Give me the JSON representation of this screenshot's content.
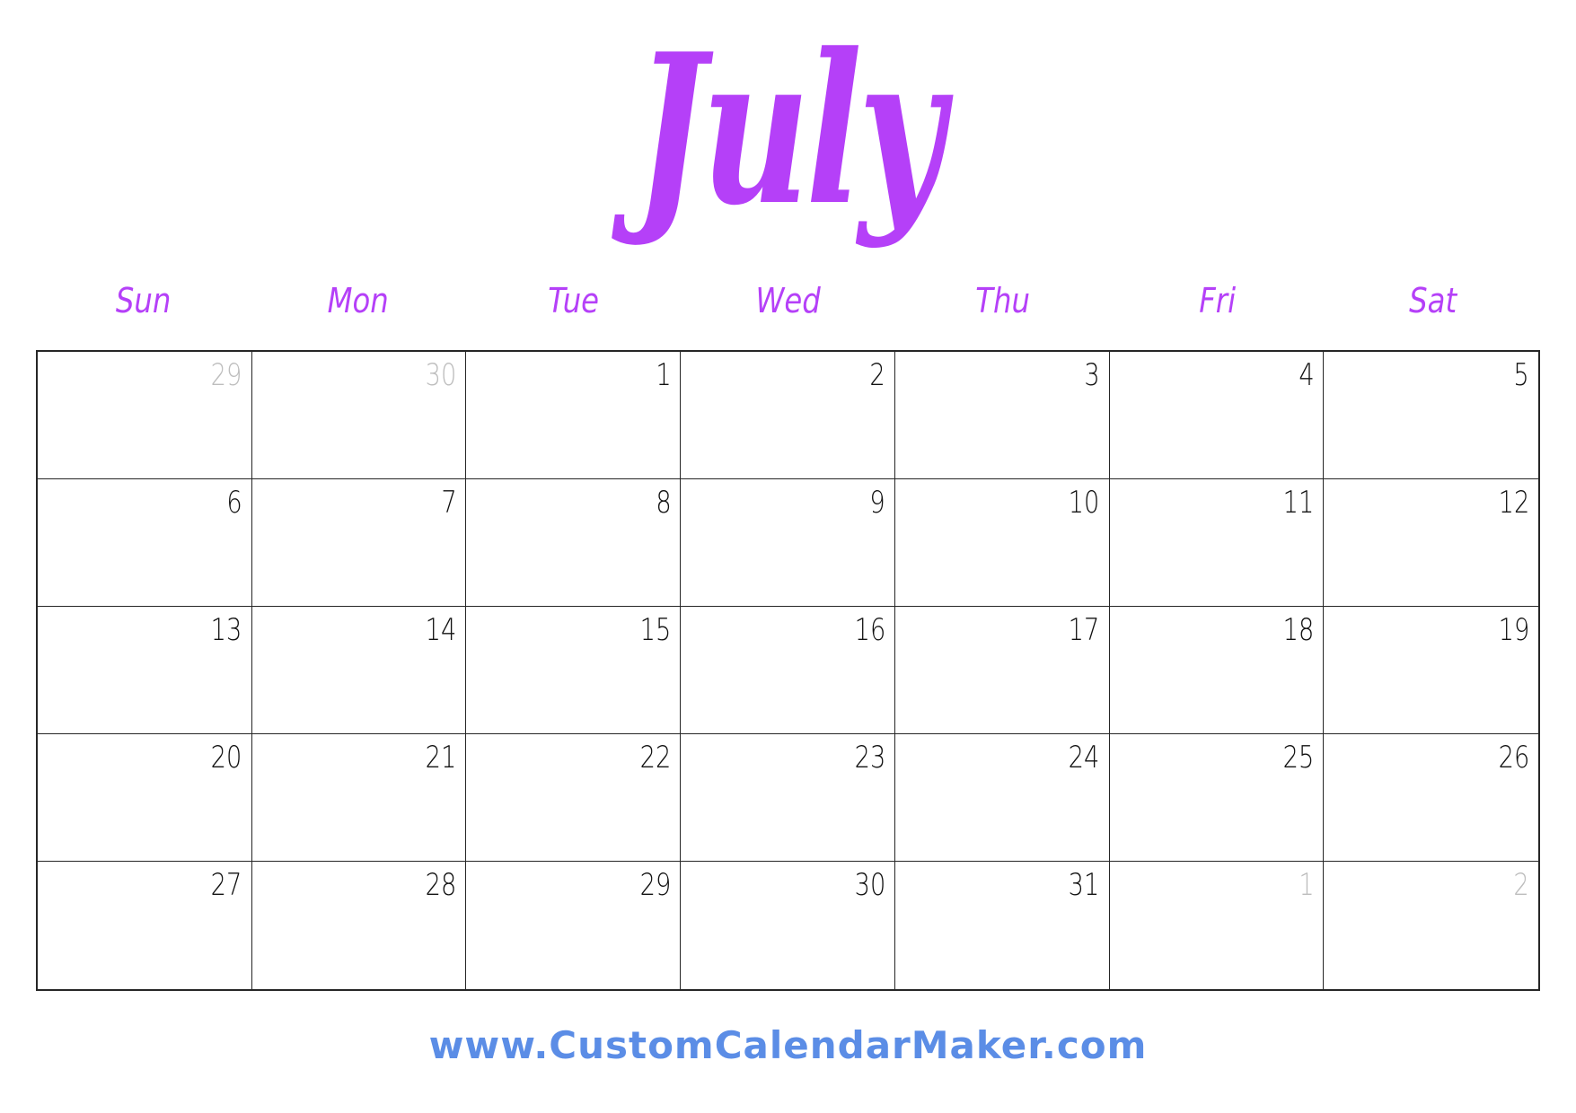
{
  "calendar": {
    "month": "July",
    "colors": {
      "accent": "#b540f8",
      "text": "#111111",
      "muted": "#bdbdbd",
      "footer": "#5b8de6",
      "border": "#262626"
    },
    "weekdays": [
      "Sun",
      "Mon",
      "Tue",
      "Wed",
      "Thu",
      "Fri",
      "Sat"
    ],
    "weeks": [
      [
        {
          "d": "29",
          "other": true
        },
        {
          "d": "30",
          "other": true
        },
        {
          "d": "1"
        },
        {
          "d": "2"
        },
        {
          "d": "3"
        },
        {
          "d": "4"
        },
        {
          "d": "5"
        }
      ],
      [
        {
          "d": "6"
        },
        {
          "d": "7"
        },
        {
          "d": "8"
        },
        {
          "d": "9"
        },
        {
          "d": "10"
        },
        {
          "d": "11"
        },
        {
          "d": "12"
        }
      ],
      [
        {
          "d": "13"
        },
        {
          "d": "14"
        },
        {
          "d": "15"
        },
        {
          "d": "16"
        },
        {
          "d": "17"
        },
        {
          "d": "18"
        },
        {
          "d": "19"
        }
      ],
      [
        {
          "d": "20"
        },
        {
          "d": "21"
        },
        {
          "d": "22"
        },
        {
          "d": "23"
        },
        {
          "d": "24"
        },
        {
          "d": "25"
        },
        {
          "d": "26"
        }
      ],
      [
        {
          "d": "27"
        },
        {
          "d": "28"
        },
        {
          "d": "29"
        },
        {
          "d": "30"
        },
        {
          "d": "31"
        },
        {
          "d": "1",
          "other": true
        },
        {
          "d": "2",
          "other": true
        }
      ]
    ]
  },
  "footer": {
    "text": "www.CustomCalendarMaker.com"
  }
}
